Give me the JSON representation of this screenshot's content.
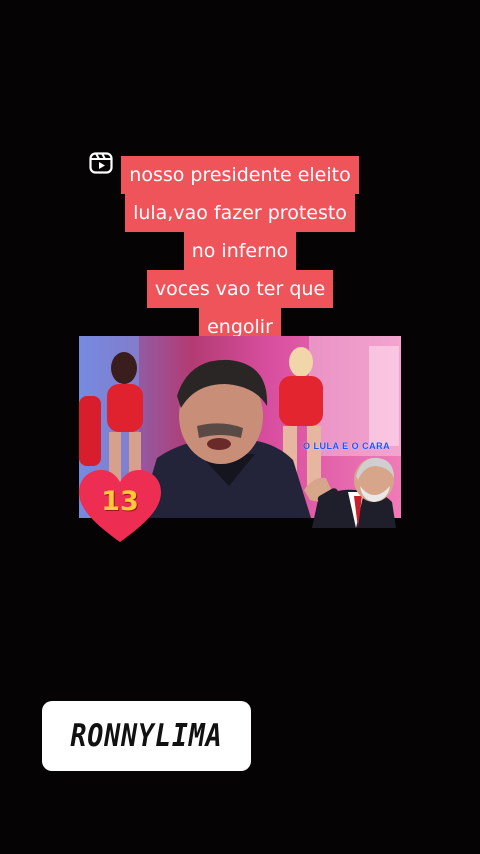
{
  "caption": {
    "lines": [
      "nosso presidente eleito",
      "lula,vao fazer protesto",
      "no inferno",
      "voces vao ter que",
      "engolir"
    ]
  },
  "video": {
    "overlay_text": "O LULA E O CARA"
  },
  "heart_sticker": {
    "icon": "heart-icon",
    "number": "13",
    "color": "#ee2d52"
  },
  "username_tag": {
    "text": "RONNYLIMA"
  },
  "colors": {
    "background": "#050304",
    "caption_bg": "#f0545b",
    "overlay_text": "#1a53ff"
  }
}
